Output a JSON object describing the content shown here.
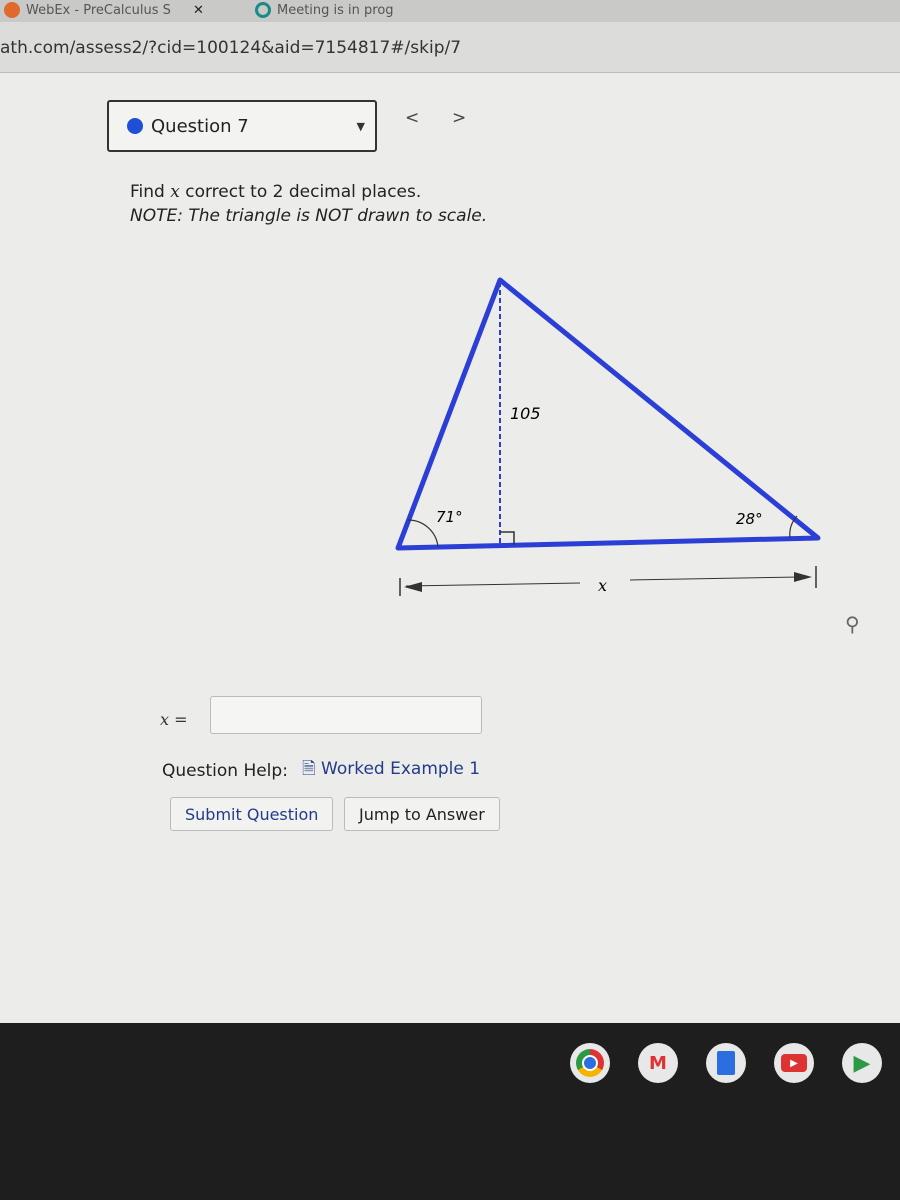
{
  "browser": {
    "tabs": [
      {
        "title": "WebEx - PreCalculus S"
      },
      {
        "title": "Meeting is in prog"
      }
    ],
    "url": "ath.com/assess2/?cid=100124&aid=7154817#/skip/7"
  },
  "question": {
    "selector": "Question 7",
    "prompt_pre": "Find ",
    "prompt_var": "x",
    "prompt_post": " correct to 2 decimal places.",
    "note": "NOTE: The triangle is NOT drawn to scale."
  },
  "diagram": {
    "height_label": "105",
    "left_angle": "71°",
    "right_angle": "28°",
    "base_label": "x",
    "color": "#2b3fd6"
  },
  "answer": {
    "label": "x =",
    "value": ""
  },
  "help": {
    "label": "Question Help:",
    "worked_example": "Worked Example 1"
  },
  "buttons": {
    "submit": "Submit Question",
    "jump": "Jump to Answer"
  },
  "shelf": {
    "apps": [
      "chrome-icon",
      "gmail-icon",
      "docs-icon",
      "youtube-icon",
      "play-store-icon"
    ]
  }
}
